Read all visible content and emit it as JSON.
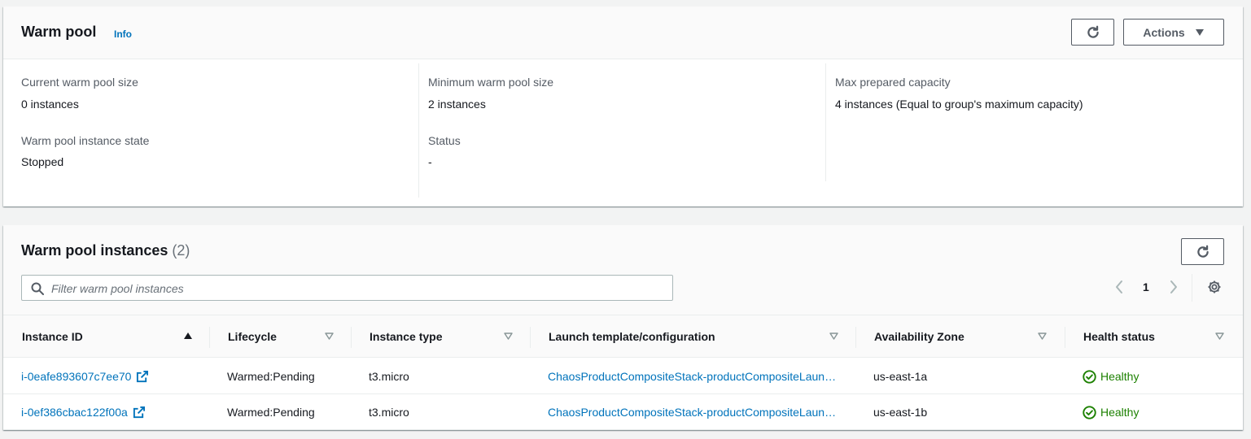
{
  "warm_pool": {
    "title": "Warm pool",
    "info_label": "Info",
    "actions_label": "Actions",
    "details": [
      {
        "label": "Current warm pool size",
        "value": "0 instances"
      },
      {
        "label": "Warm pool instance state",
        "value": "Stopped"
      },
      {
        "label": "Minimum warm pool size",
        "value": "2 instances"
      },
      {
        "label": "Status",
        "value": "-"
      },
      {
        "label": "Max prepared capacity",
        "value": "4 instances (Equal to group's maximum capacity)"
      }
    ]
  },
  "instances": {
    "title": "Warm pool instances",
    "count": "(2)",
    "filter_placeholder": "Filter warm pool instances",
    "page": "1",
    "columns": [
      "Instance ID",
      "Lifecycle",
      "Instance type",
      "Launch template/configuration",
      "Availability Zone",
      "Health status"
    ],
    "rows": [
      {
        "instance_id": "i-0eafe893607c7ee70",
        "lifecycle": "Warmed:Pending",
        "instance_type": "t3.micro",
        "launch_template": "ChaosProductCompositeStack-productCompositeLaunchTemplate",
        "availability_zone": "us-east-1a",
        "health_status": "Healthy"
      },
      {
        "instance_id": "i-0ef386cbac122f00a",
        "lifecycle": "Warmed:Pending",
        "instance_type": "t3.micro",
        "launch_template": "ChaosProductCompositeStack-productCompositeLaunchTemplate",
        "availability_zone": "us-east-1b",
        "health_status": "Healthy"
      }
    ]
  },
  "colors": {
    "link": "#0073bb",
    "healthy": "#1d8102",
    "background": "#f2f3f3",
    "header": "#fafafa"
  },
  "icons": [
    "refresh-icon",
    "caret-down-icon",
    "search-icon",
    "chevron-left-icon",
    "chevron-right-icon",
    "gear-icon",
    "sort-ascending-icon",
    "sort-icon",
    "external-link-icon",
    "status-positive-icon"
  ]
}
